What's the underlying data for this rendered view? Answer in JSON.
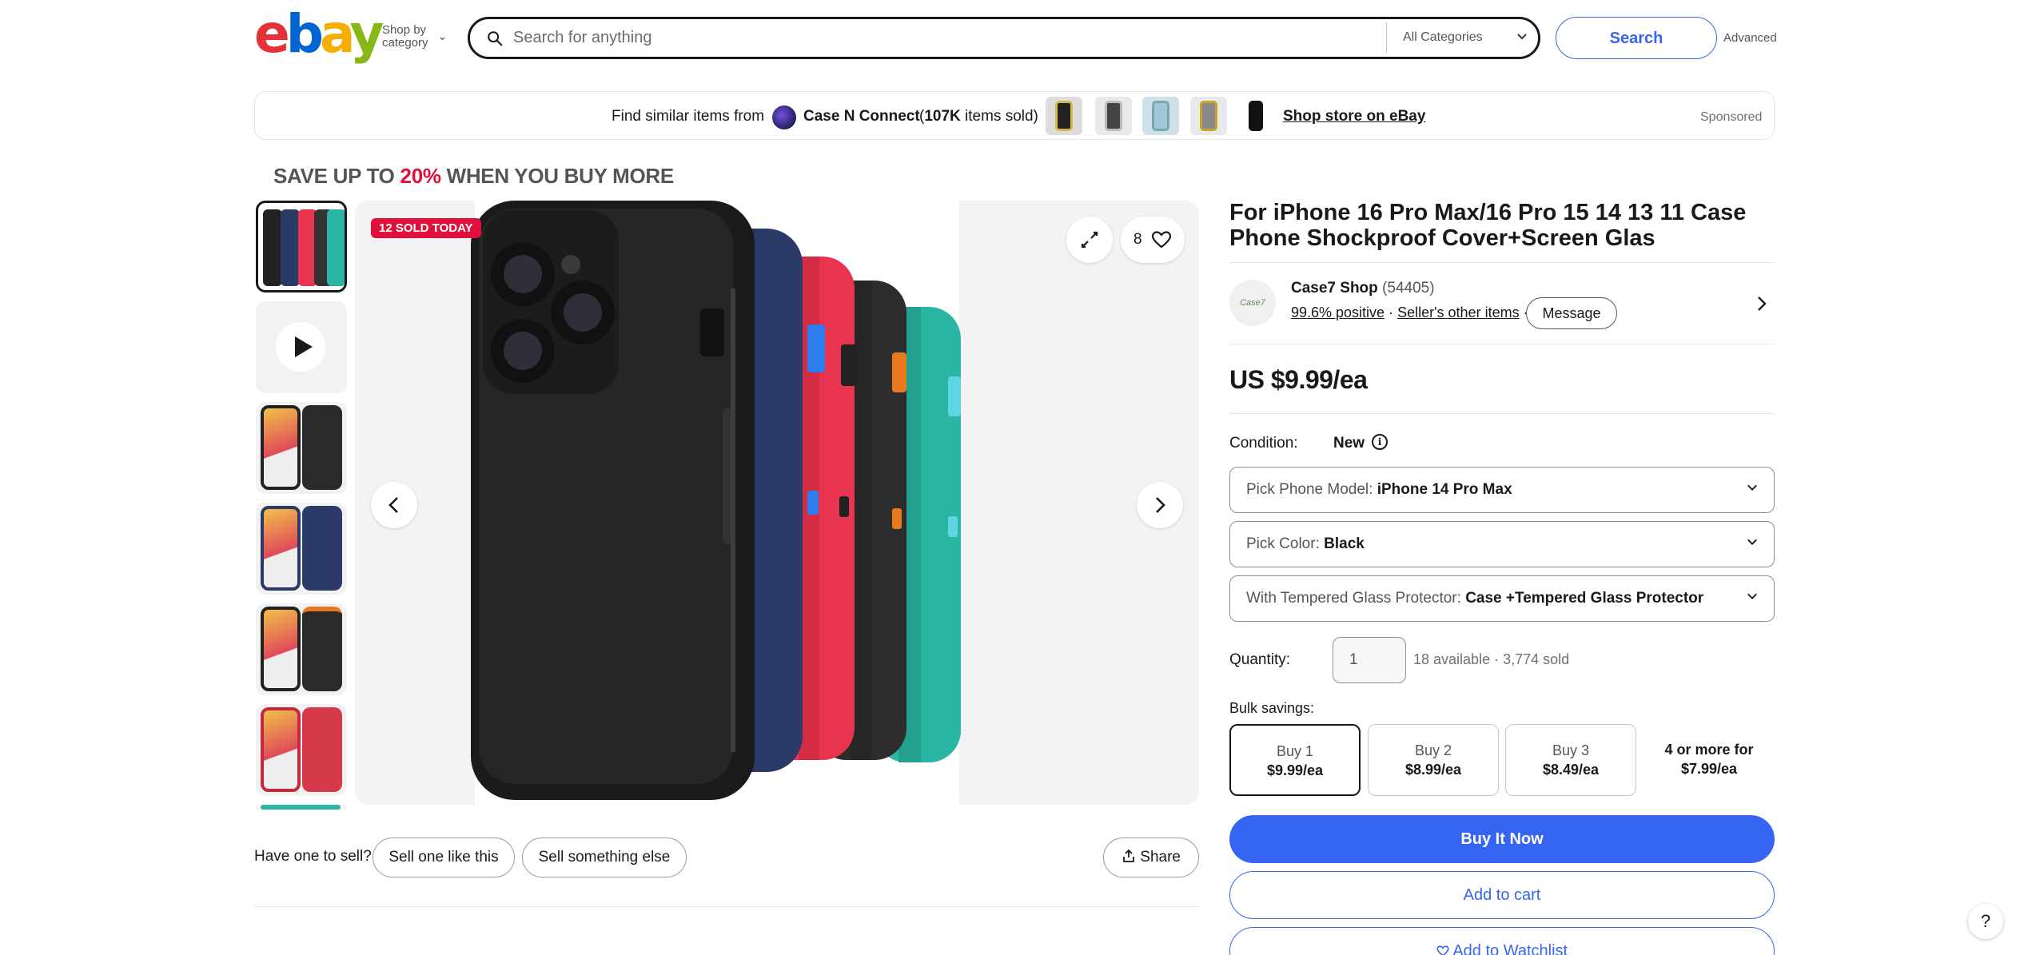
{
  "header": {
    "logo": [
      "e",
      "b",
      "a",
      "y"
    ],
    "shop_by_line1": "Shop by",
    "shop_by_line2": "category",
    "search_placeholder": "Search for anything",
    "category": "All Categories",
    "search_button": "Search",
    "advanced": "Advanced"
  },
  "store_banner": {
    "find_text": "Find similar items from",
    "store_name": "Case N Connect",
    "sold_count": "107K",
    "sold_suffix": " items sold)",
    "sold_prefix": "(",
    "shop_link": "Shop store on eBay",
    "sponsored": "Sponsored"
  },
  "promo": {
    "prefix": "SAVE UP TO ",
    "percent": "20%",
    "suffix": " WHEN YOU BUY MORE"
  },
  "gallery": {
    "badge": "12 SOLD TODAY",
    "watch_count": "8"
  },
  "sell": {
    "question": "Have one to sell?",
    "sell_like": "Sell one like this",
    "sell_else": "Sell something else",
    "share": "Share"
  },
  "product": {
    "title": "For iPhone 16 Pro Max/16 Pro 15 14 13 11 Case Phone Shockproof Cover+Screen Glas",
    "price": "US $9.99/ea",
    "condition_label": "Condition:",
    "condition_value": "New"
  },
  "seller": {
    "avatar_text": "Case7",
    "name": "Case7 Shop",
    "feedback_count": "(54405)",
    "positive": "99.6% positive",
    "other_items": "Seller's other items",
    "message": "Message"
  },
  "options": [
    {
      "label": "Pick Phone Model: ",
      "value": "iPhone 14 Pro Max"
    },
    {
      "label": "Pick Color: ",
      "value": "Black"
    },
    {
      "label": "With Tempered Glass Protector: ",
      "value": "Case +Tempered Glass Protector"
    }
  ],
  "quantity": {
    "label": "Quantity:",
    "value": "1",
    "available": "18 available · 3,774 sold"
  },
  "bulk": {
    "label": "Bulk savings:",
    "tiers": [
      {
        "line1": "Buy 1",
        "line2": "$9.99/ea"
      },
      {
        "line1": "Buy 2",
        "line2": "$8.99/ea"
      },
      {
        "line1": "Buy 3",
        "line2": "$8.49/ea"
      },
      {
        "line1": "4 or more for",
        "line2": "$7.99/ea"
      }
    ],
    "selected_index": 0
  },
  "actions": {
    "buy_now": "Buy It Now",
    "add_to_cart": "Add to cart",
    "watchlist": "Add to Watchlist"
  },
  "help": "?",
  "colors": {
    "accent": "#3665f3",
    "promo_red": "#e0103a",
    "case_black": "#222222",
    "case_navy": "#2b3a67",
    "case_red": "#e8344e",
    "case_teal": "#2bb5a5",
    "case_orange": "#e87a1e"
  }
}
